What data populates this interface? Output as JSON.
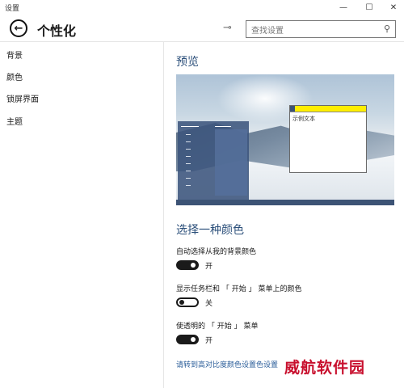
{
  "window": {
    "title": "设置",
    "minimize": "—",
    "maximize": "☐",
    "close": "✕"
  },
  "header": {
    "back_glyph": "←",
    "title": "个性化",
    "pin_glyph": "⊸"
  },
  "search": {
    "placeholder": "查找设置",
    "icon_glyph": "⚲"
  },
  "sidebar": {
    "items": [
      {
        "label": "背景"
      },
      {
        "label": "颜色"
      },
      {
        "label": "锁屏界面"
      },
      {
        "label": "主题"
      }
    ]
  },
  "preview": {
    "title": "预览",
    "sample_text": "示例文本",
    "accent_color": "#ffee00"
  },
  "colors": {
    "title": "选择一种颜色",
    "options": [
      {
        "label": "自动选择从我的背景颜色",
        "state": "开",
        "on": true
      },
      {
        "label": "显示任务栏和 「 开始 」 菜单上的颜色",
        "state": "关",
        "on": false
      },
      {
        "label": "使透明的 「 开始 」 菜单",
        "state": "开",
        "on": true
      }
    ],
    "link": "请转到高对比度颜色设置色设置"
  },
  "watermark": {
    "text": "威航软件园",
    "color": "#c8102e"
  }
}
